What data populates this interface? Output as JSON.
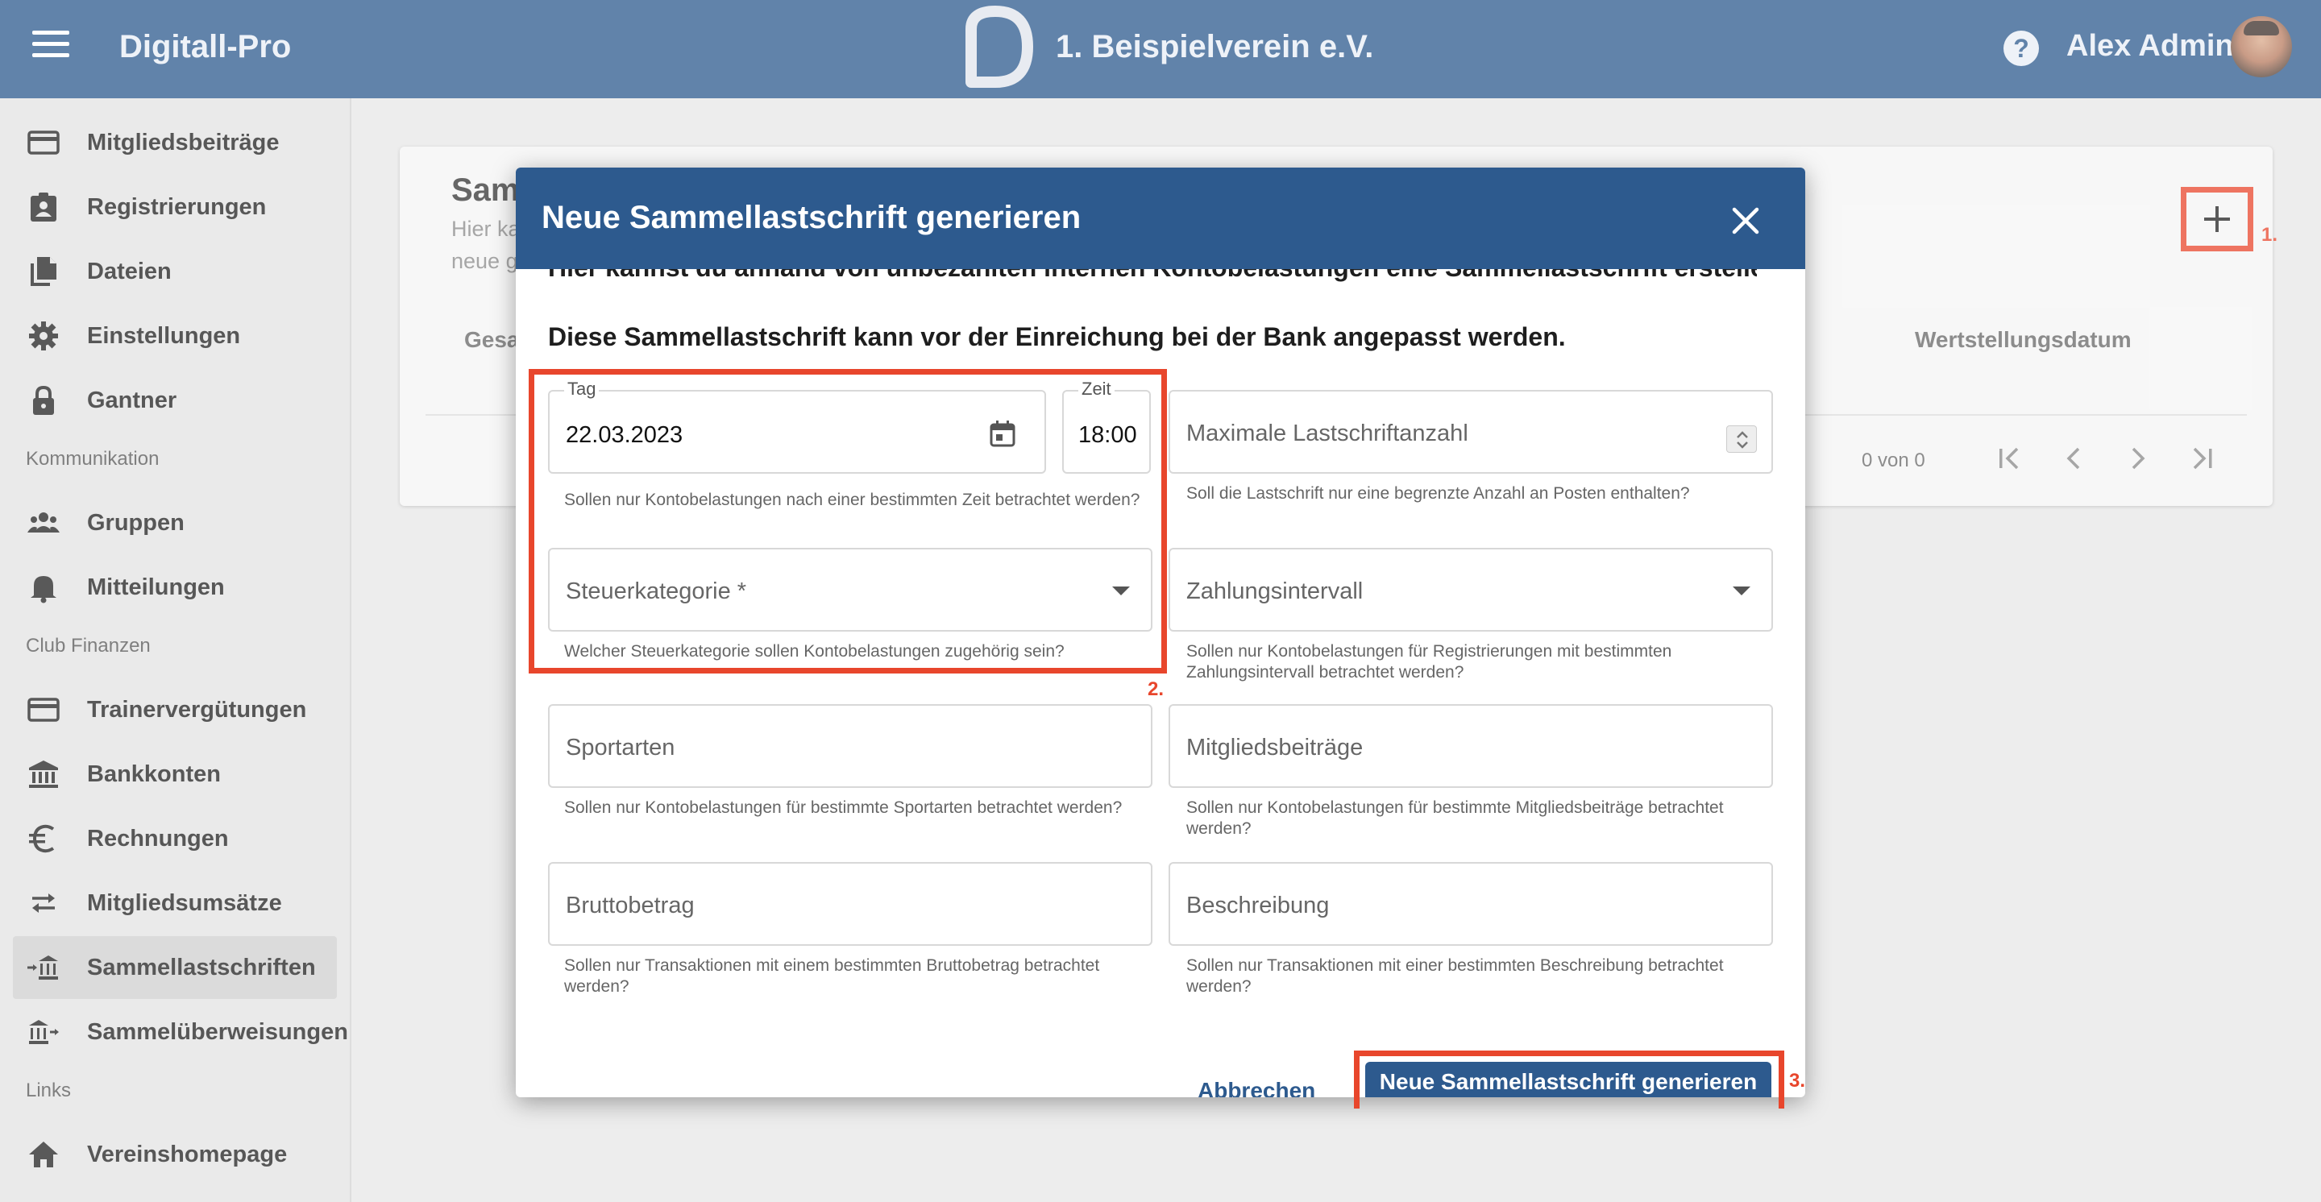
{
  "header": {
    "app_title": "Digitall-Pro",
    "org_name": "1. Beispielverein e.V.",
    "user_name": "Alex Admin"
  },
  "sidebar": {
    "items": [
      {
        "label": "Mitgliedsbeiträge",
        "icon": "credit-card-icon"
      },
      {
        "label": "Registrierungen",
        "icon": "badge-icon"
      },
      {
        "label": "Dateien",
        "icon": "files-icon"
      },
      {
        "label": "Einstellungen",
        "icon": "gear-icon"
      },
      {
        "label": "Gantner",
        "icon": "lock-icon"
      }
    ],
    "section_communication": "Kommunikation",
    "communication_items": [
      {
        "label": "Gruppen",
        "icon": "group-icon"
      },
      {
        "label": "Mitteilungen",
        "icon": "bell-icon"
      }
    ],
    "section_finance": "Club Finanzen",
    "finance_items": [
      {
        "label": "Trainervergütungen",
        "icon": "credit-card-icon"
      },
      {
        "label": "Bankkonten",
        "icon": "bank-icon"
      },
      {
        "label": "Rechnungen",
        "icon": "euro-icon"
      },
      {
        "label": "Mitgliedsumsätze",
        "icon": "swap-icon"
      },
      {
        "label": "Sammellastschriften",
        "icon": "bank-in-icon"
      },
      {
        "label": "Sammelüberweisungen",
        "icon": "bank-out-icon"
      }
    ],
    "section_links": "Links",
    "links_items": [
      {
        "label": "Vereinshomepage",
        "icon": "home-icon"
      }
    ]
  },
  "card": {
    "title_fragment": "Sam",
    "desc_line1": "Hier ka",
    "desc_line2": "neue g",
    "col_fragment": "Gesa",
    "col_value_date": "Wertstellungsdatum",
    "paging": "0 von 0"
  },
  "annotations": {
    "one": "1.",
    "two": "2.",
    "three": "3."
  },
  "dialog": {
    "title": "Neue Sammellastschrift generieren",
    "intro1": "Hier kannst du anhand von unbezahlten internen Kontobelastungen eine Sammellastschrift erstellen.",
    "intro2": "Diese Sammellastschrift kann vor der Einreichung bei der Bank angepasst werden.",
    "tag_label": "Tag",
    "tag_value": "22.03.2023",
    "zeit_label": "Zeit",
    "zeit_value": "18:00",
    "date_hint": "Sollen nur Kontobelastungen nach einer bestimmten Zeit betrachtet werden?",
    "max_placeholder": "Maximale Lastschriftanzahl",
    "max_hint": "Soll die Lastschrift nur eine begrenzte Anzahl an Posten enthalten?",
    "tax_placeholder": "Steuerkategorie *",
    "tax_hint": "Welcher Steuerkategorie sollen Kontobelastungen zugehörig sein?",
    "interval_placeholder": "Zahlungsintervall",
    "interval_hint": "Sollen nur Kontobelastungen für Registrierungen mit bestimmten Zahlungsintervall betrachtet werden?",
    "sport_placeholder": "Sportarten",
    "sport_hint": "Sollen nur Kontobelastungen für bestimmte Sportarten betrachtet werden?",
    "fees_placeholder": "Mitgliedsbeiträge",
    "fees_hint": "Sollen nur Kontobelastungen für bestimmte Mitgliedsbeiträge betrachtet werden?",
    "gross_placeholder": "Bruttobetrag",
    "gross_hint": "Sollen nur Transaktionen mit einem bestimmten Bruttobetrag betrachtet werden?",
    "desc_placeholder": "Beschreibung",
    "desc_hint": "Sollen nur Transaktionen mit einer bestimmten Beschreibung betrachtet werden?",
    "cancel_label": "Abbrechen",
    "submit_label": "Neue Sammellastschrift generieren"
  },
  "colors": {
    "primary": "#2d5a8e",
    "annotation": "#e8462c"
  }
}
